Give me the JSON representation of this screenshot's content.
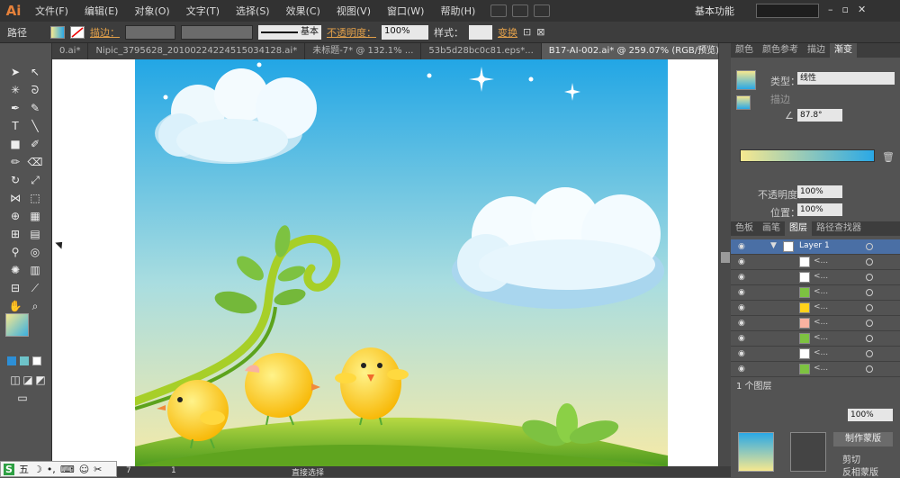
{
  "app": {
    "logo": "Ai"
  },
  "menu": [
    "文件(F)",
    "编辑(E)",
    "对象(O)",
    "文字(T)",
    "选择(S)",
    "效果(C)",
    "视图(V)",
    "窗口(W)",
    "帮助(H)"
  ],
  "workspace": "基本功能",
  "control_bar": {
    "path_label": "路径",
    "stroke_link": "描边：",
    "stroke_style": "基本",
    "opacity_link": "不透明度：",
    "opacity_value": "100%",
    "style_label": "样式：",
    "transform_link": "变换"
  },
  "doc_tabs": [
    "0.ai*",
    "Nipic_3795628_20100224224515034128.ai*",
    "未标题-7* @ 132.1% ...",
    "53b5d28bc0c81.eps*...",
    "B17-AI-002.ai* @ 259.07% (RGB/预览)"
  ],
  "active_tab_index": 4,
  "gradient_panel": {
    "tabs": [
      "颜色",
      "颜色参考",
      "描边",
      "渐变"
    ],
    "type_label": "类型：",
    "type_value": "线性",
    "stroke_label": "描边",
    "angle_value": "87.8°",
    "opacity_label": "不透明度：",
    "opacity_value": "100%",
    "location_label": "位置：",
    "location_value": "100%",
    "ramp_colors": [
      "#f6e88f",
      "#2aa8e6"
    ]
  },
  "layers_panel": {
    "tabs": [
      "色板",
      "画笔",
      "图层",
      "路径查找器"
    ],
    "layer_name": "Layer 1",
    "sublayers": [
      "<...",
      "<...",
      "<...",
      "<...",
      "<...",
      "<...",
      "<...",
      "<..."
    ],
    "footer": "1 个图层"
  },
  "bottom_panel": {
    "opacity_value": "100%",
    "make_mask": "制作蒙版",
    "clip": "剪切",
    "invert_mask": "反相蒙版"
  },
  "status": {
    "zoom": "7",
    "page": "1",
    "tool": "直接选择"
  },
  "ime": {
    "label": "五"
  },
  "colors": {
    "accent": "#e5813a",
    "sky_top": "#22a6e5",
    "sky_bottom": "#f5eaa8",
    "grass": "#7bb82a",
    "chick": "#ffd21a"
  }
}
